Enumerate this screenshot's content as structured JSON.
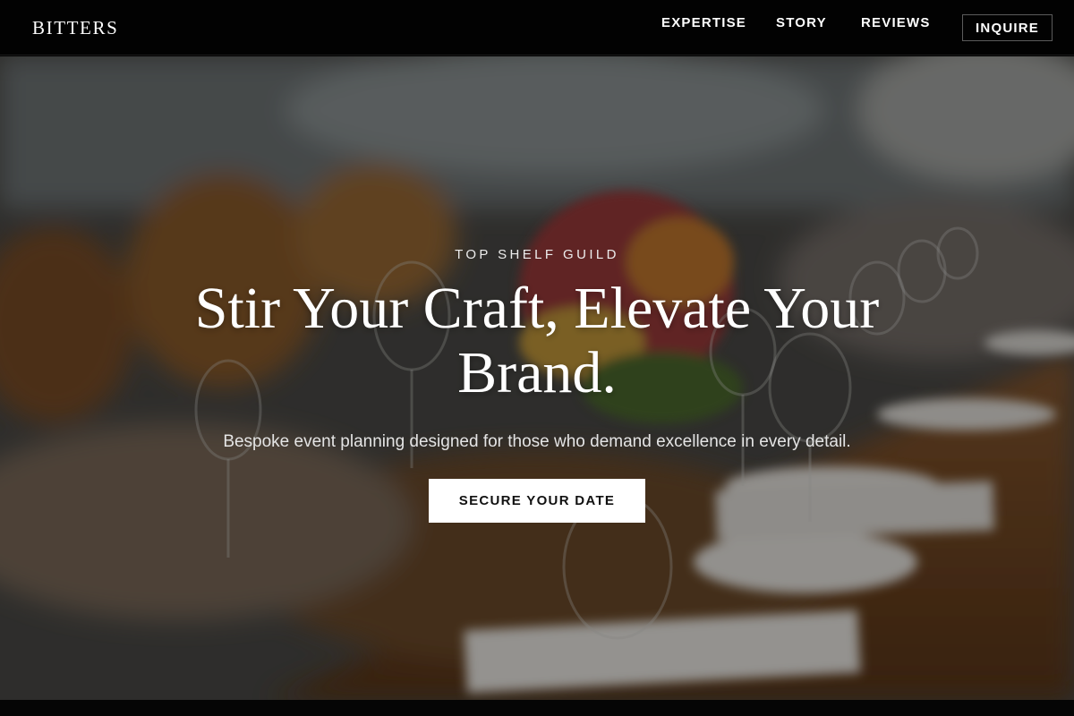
{
  "header": {
    "logo": "BITTERS",
    "nav": [
      "EXPERTISE",
      "STORY",
      "REVIEWS"
    ],
    "inquire_label": "INQUIRE"
  },
  "hero": {
    "eyebrow": "TOP SHELF GUILD",
    "headline": "Stir Your Craft, Elevate Your Brand.",
    "subtitle": "Bespoke event planning designed for those who demand excellence in every detail.",
    "cta_label": "SECURE YOUR DATE"
  },
  "colors": {
    "header_bg": "#020202",
    "cta_bg": "#ffffff",
    "cta_text": "#111111",
    "text": "#ffffff"
  }
}
